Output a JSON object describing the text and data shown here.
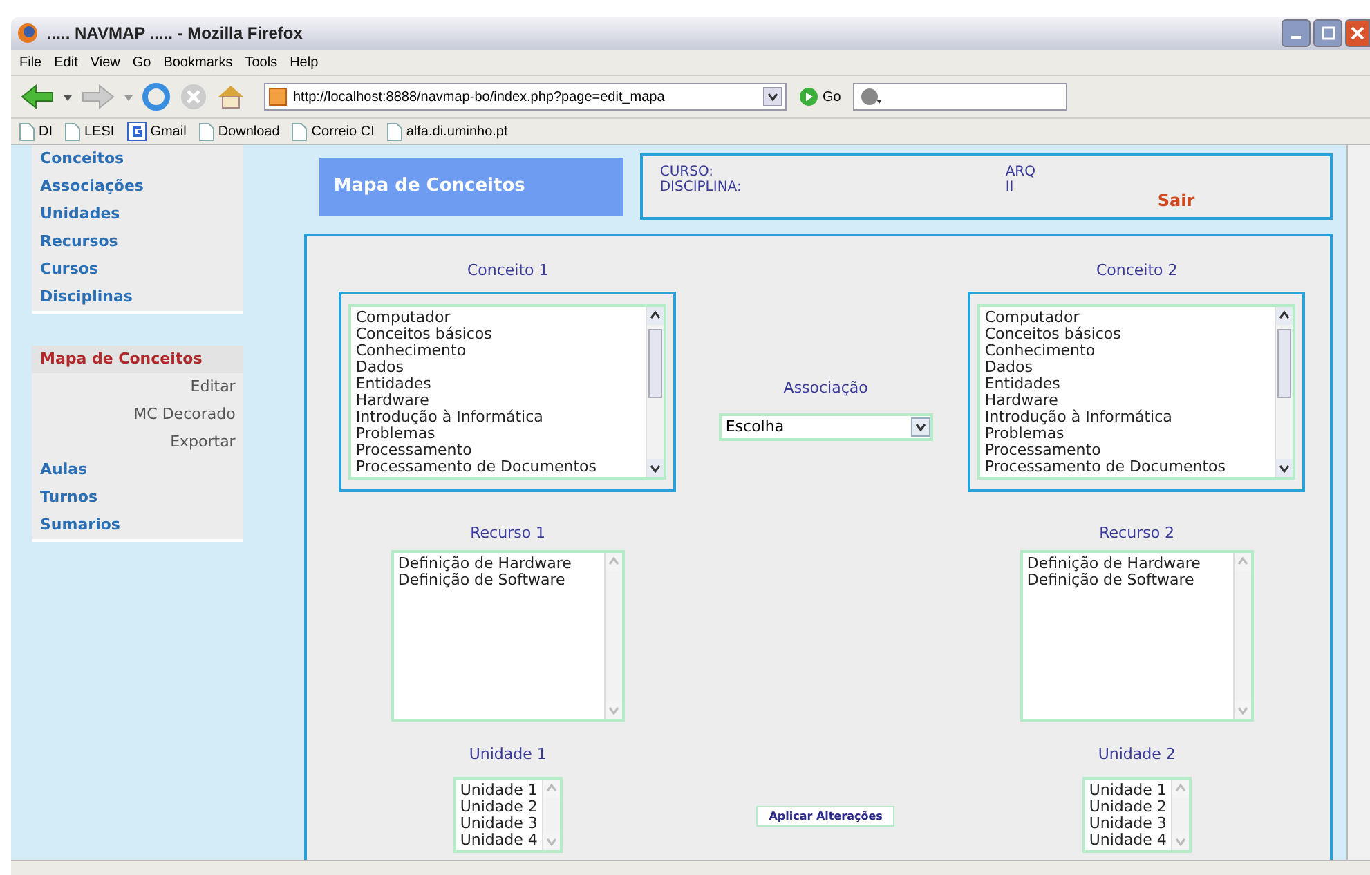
{
  "window": {
    "title": "..... NAVMAP ..... - Mozilla Firefox"
  },
  "menu": [
    "File",
    "Edit",
    "View",
    "Go",
    "Bookmarks",
    "Tools",
    "Help"
  ],
  "address": {
    "url": "http://localhost:8888/navmap-bo/index.php?page=edit_mapa",
    "go": "Go"
  },
  "bookmarks": [
    {
      "label": "DI",
      "kind": "page"
    },
    {
      "label": "LESI",
      "kind": "page"
    },
    {
      "label": "Gmail",
      "kind": "gmail"
    },
    {
      "label": "Download",
      "kind": "page"
    },
    {
      "label": "Correio CI",
      "kind": "page"
    },
    {
      "label": "alfa.di.uminho.pt",
      "kind": "page"
    }
  ],
  "sidebar": {
    "items": [
      {
        "label": "Conceitos",
        "selected": false
      },
      {
        "label": "Associações",
        "selected": false
      },
      {
        "label": "Unidades",
        "selected": false
      },
      {
        "label": "Recursos",
        "selected": false
      },
      {
        "label": "Cursos",
        "selected": false
      },
      {
        "label": "Disciplinas",
        "selected": false
      }
    ],
    "items2": [
      {
        "label": "Mapa de Conceitos",
        "selected": true,
        "children": [
          {
            "label": "Editar"
          },
          {
            "label": "MC Decorado"
          },
          {
            "label": "Exportar"
          }
        ]
      },
      {
        "label": "Aulas",
        "selected": false
      },
      {
        "label": "Turnos",
        "selected": false
      },
      {
        "label": "Sumarios",
        "selected": false
      }
    ]
  },
  "header": {
    "title": "Mapa de Conceitos",
    "info": [
      {
        "label": "CURSO:",
        "value": "ARQ"
      },
      {
        "label": "DISCIPLINA:",
        "value": "II"
      }
    ],
    "logout": "Sair"
  },
  "panel": {
    "concepts": [
      {
        "label": "Conceito 1",
        "options": [
          "Computador",
          "Conceitos básicos",
          "Conhecimento",
          "Dados",
          "Entidades",
          "Hardware",
          "Introdução à Informática",
          "Problemas",
          "Processamento",
          "Processamento de Documentos"
        ]
      },
      {
        "label": "Conceito 2",
        "options": [
          "Computador",
          "Conceitos básicos",
          "Conhecimento",
          "Dados",
          "Entidades",
          "Hardware",
          "Introdução à Informática",
          "Problemas",
          "Processamento",
          "Processamento de Documentos"
        ]
      }
    ],
    "association": {
      "label": "Associação",
      "value": "Escolha"
    },
    "resources": [
      {
        "label": "Recurso 1",
        "options": [
          "Definição de Hardware",
          "Definição de Software"
        ]
      },
      {
        "label": "Recurso 2",
        "options": [
          "Definição de Hardware",
          "Definição de Software"
        ]
      }
    ],
    "units": [
      {
        "label": "Unidade 1",
        "options": [
          "Unidade 1",
          "Unidade 2",
          "Unidade 3",
          "Unidade 4"
        ]
      },
      {
        "label": "Unidade 2",
        "options": [
          "Unidade 1",
          "Unidade 2",
          "Unidade 3",
          "Unidade 4"
        ]
      }
    ],
    "apply": "Aplicar Alterações"
  }
}
